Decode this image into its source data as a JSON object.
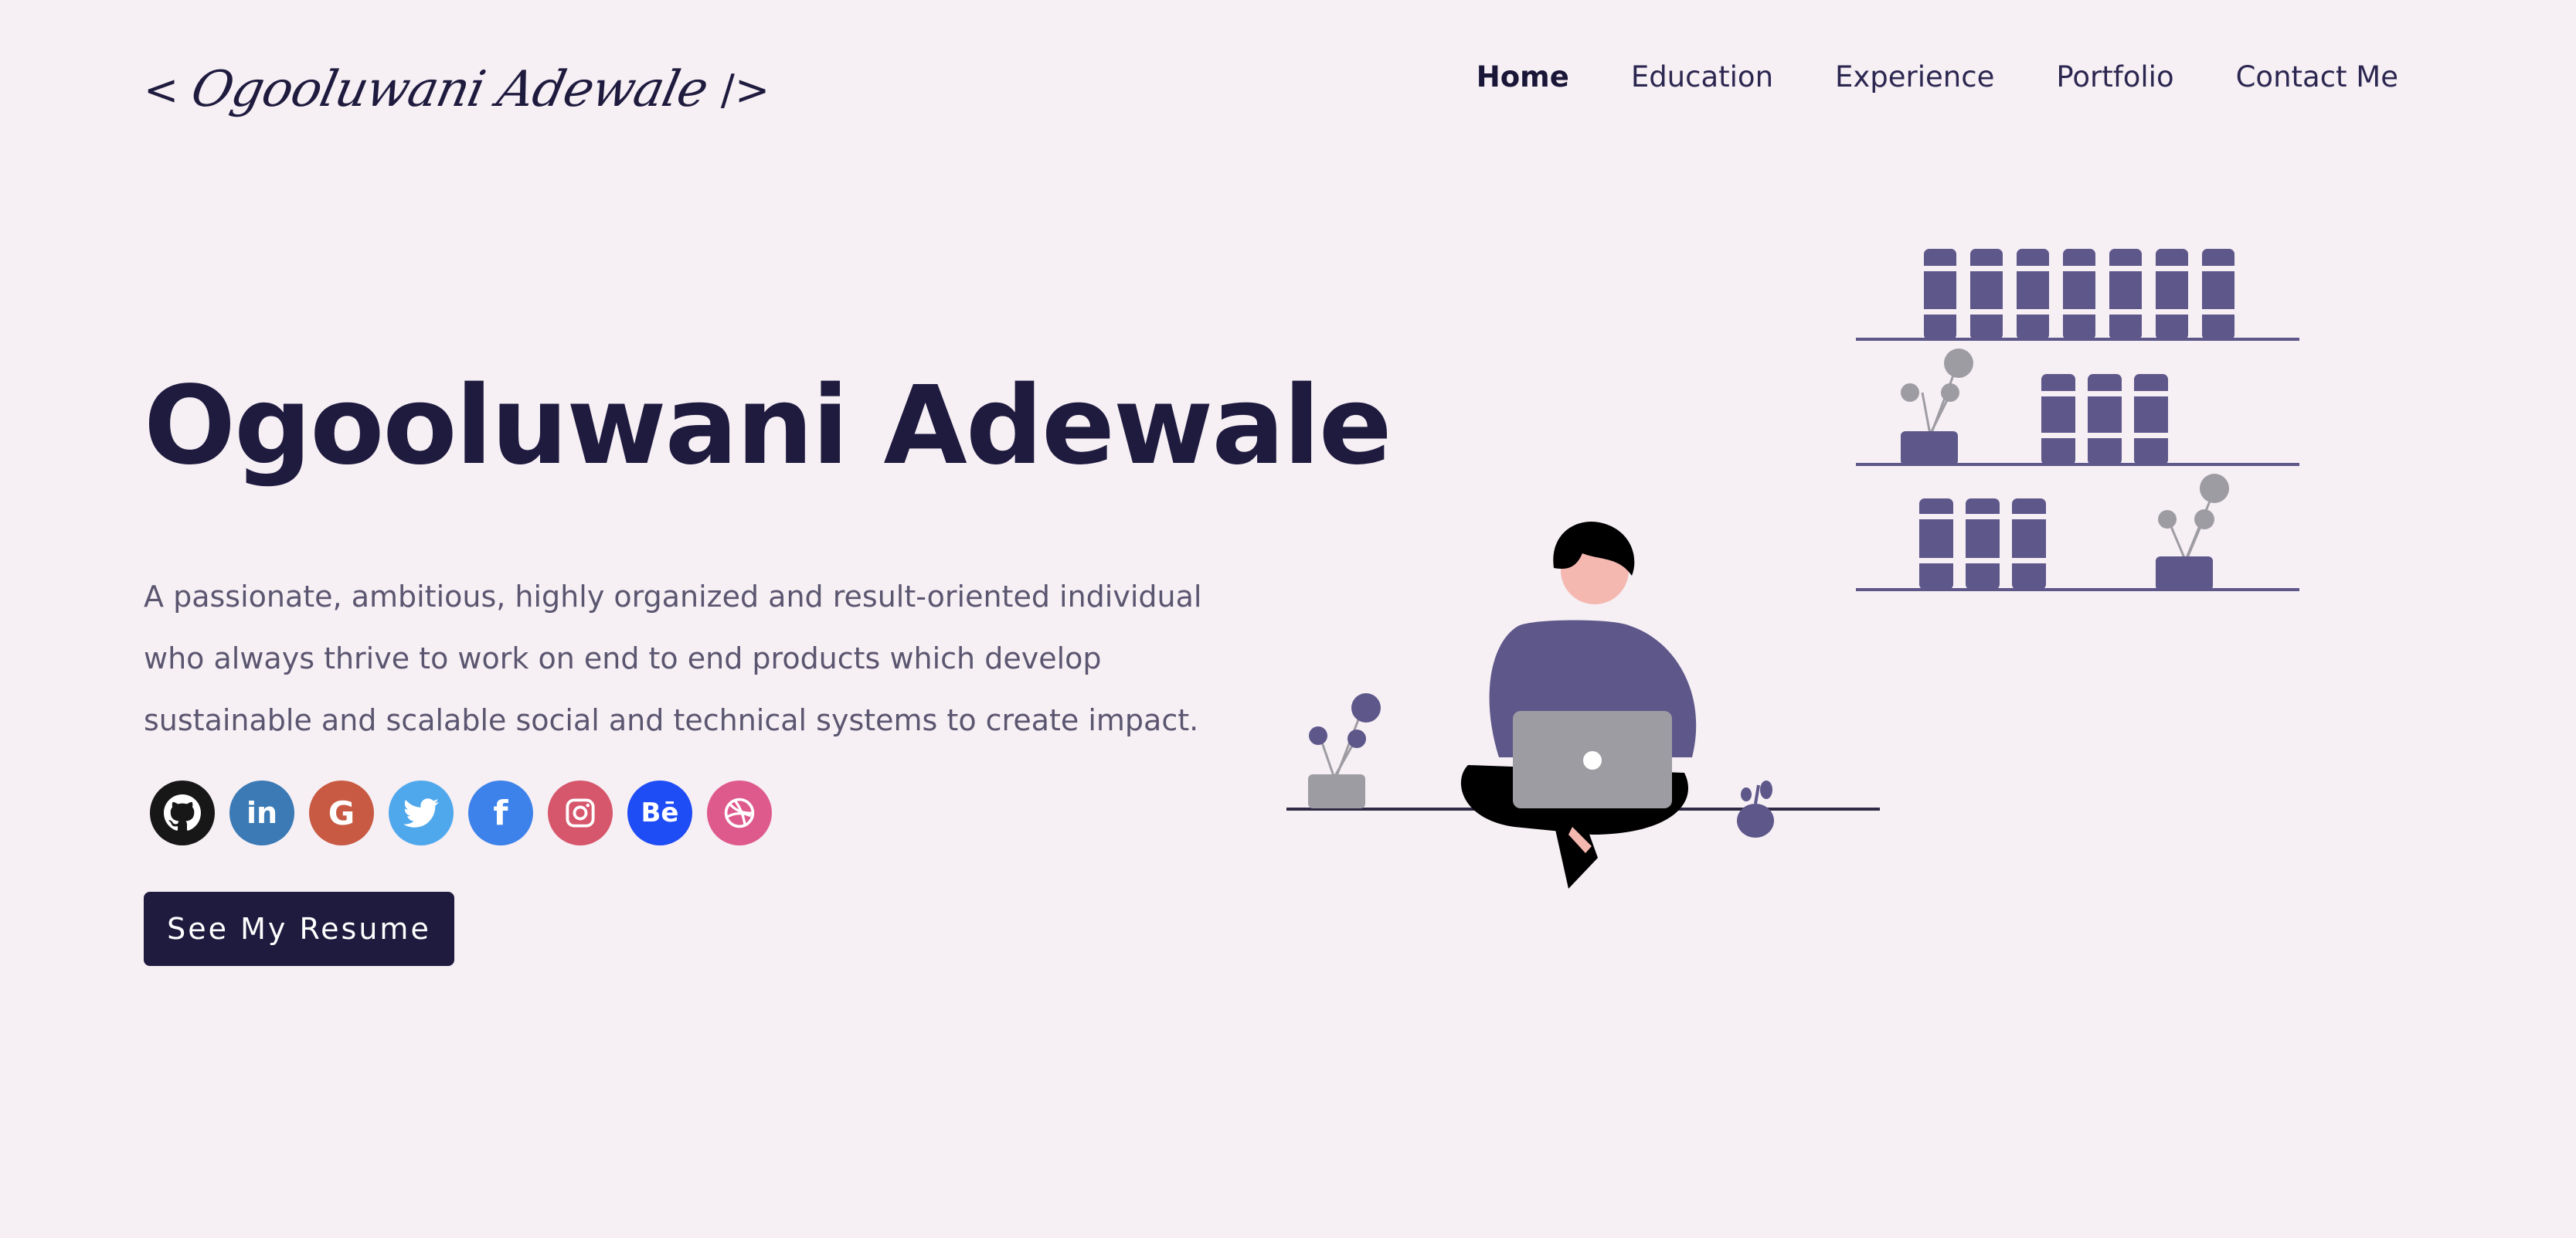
{
  "header": {
    "logo_left": "<",
    "logo_name": "Ogooluwani Adewale",
    "logo_right": "/>",
    "nav": [
      {
        "label": "Home",
        "active": true
      },
      {
        "label": "Education",
        "active": false
      },
      {
        "label": "Experience",
        "active": false
      },
      {
        "label": "Portfolio",
        "active": false
      },
      {
        "label": "Contact Me",
        "active": false
      }
    ]
  },
  "hero": {
    "title": "Ogooluwani Adewale",
    "description": "A passionate, ambitious, highly organized and result-oriented individual who always thrive to work on end to end products which develop sustainable and scalable social and technical systems to create impact.",
    "resume_button": "See My Resume"
  },
  "socials": [
    {
      "name": "github-icon",
      "glyph": "",
      "color": "#181717"
    },
    {
      "name": "linkedin-icon",
      "glyph": "in",
      "color": "#3b7ab5"
    },
    {
      "name": "google-icon",
      "glyph": "G",
      "color": "#c85a43"
    },
    {
      "name": "twitter-icon",
      "glyph": "",
      "color": "#50a8ec"
    },
    {
      "name": "facebook-icon",
      "glyph": "f",
      "color": "#3d82ea"
    },
    {
      "name": "instagram-icon",
      "glyph": "",
      "color": "#d6566b"
    },
    {
      "name": "behance-icon",
      "glyph": "Bē",
      "color": "#1e4cf5"
    },
    {
      "name": "dribbble-icon",
      "glyph": "",
      "color": "#df5a8c"
    }
  ],
  "colors": {
    "background": "#f6eff4",
    "primary": "#1f1b3f",
    "accent_purple": "#5e578a",
    "text_muted": "#5b5670"
  }
}
